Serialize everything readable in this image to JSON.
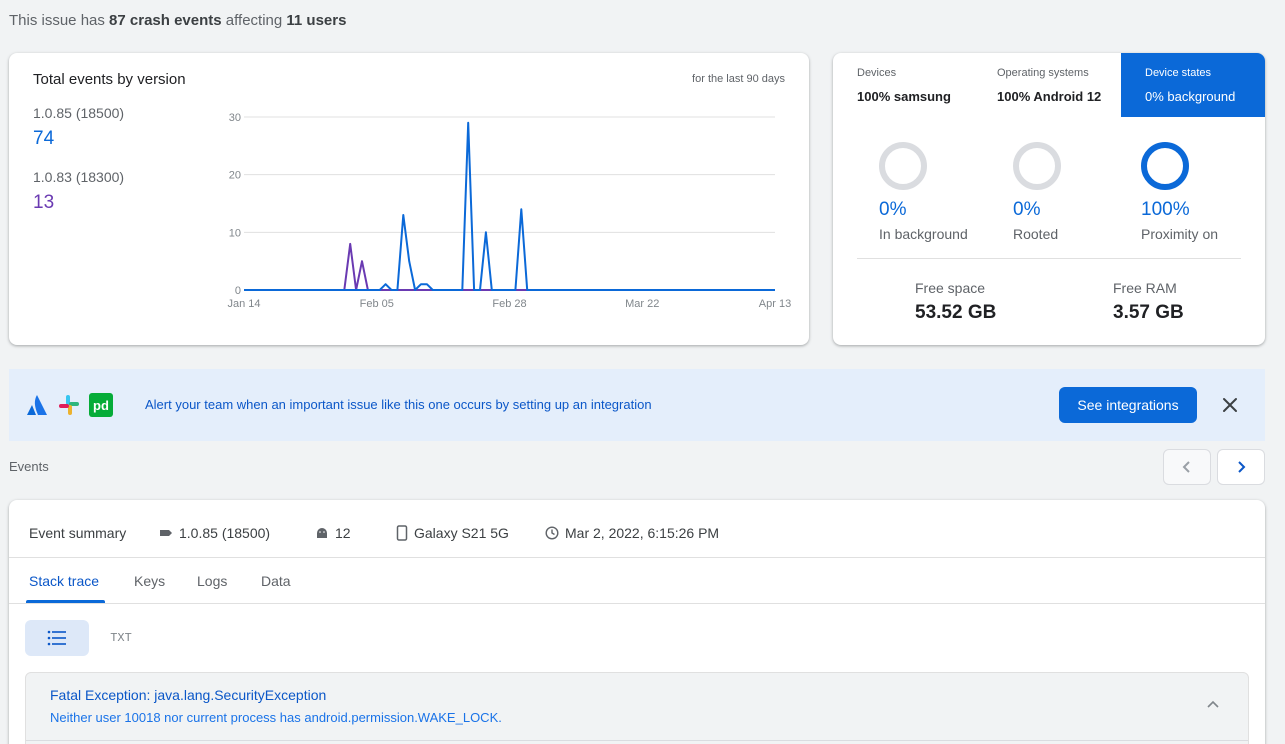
{
  "summary": {
    "prefix": "This issue has",
    "events": "87 crash events",
    "middle": "affecting",
    "users": "11 users"
  },
  "chart_card": {
    "title": "Total events by version",
    "period": "for the last 90 days",
    "versions": [
      {
        "label": "1.0.85 (18500)",
        "value": "74",
        "color": "#0b69d8"
      },
      {
        "label": "1.0.83 (18300)",
        "value": "13",
        "color": "#6a3ab2"
      }
    ]
  },
  "chart_data": {
    "type": "line",
    "title": "Total events by version",
    "x_ticks": [
      "Jan 14",
      "Feb 05",
      "Feb 28",
      "Mar 22",
      "Apr 13"
    ],
    "x_range_days": [
      0,
      90
    ],
    "y_ticks": [
      "0",
      "10",
      "20",
      "30"
    ],
    "ylim": [
      0,
      30
    ],
    "grid": true,
    "series": [
      {
        "name": "1.0.85 (18500)",
        "color": "#0b69d8",
        "points": [
          [
            0,
            0
          ],
          [
            23,
            0
          ],
          [
            24,
            1
          ],
          [
            25,
            0
          ],
          [
            26,
            0
          ],
          [
            27,
            13
          ],
          [
            28,
            5
          ],
          [
            29,
            0
          ],
          [
            30,
            1
          ],
          [
            31,
            1
          ],
          [
            32,
            0
          ],
          [
            37,
            0
          ],
          [
            38,
            29
          ],
          [
            39,
            0
          ],
          [
            40,
            0
          ],
          [
            41,
            10
          ],
          [
            42,
            0
          ],
          [
            46,
            0
          ],
          [
            47,
            14
          ],
          [
            48,
            0
          ],
          [
            90,
            0
          ]
        ]
      },
      {
        "name": "1.0.83 (18300)",
        "color": "#6a3ab2",
        "points": [
          [
            0,
            0
          ],
          [
            17,
            0
          ],
          [
            18,
            8
          ],
          [
            19,
            0
          ],
          [
            20,
            5
          ],
          [
            21,
            0
          ],
          [
            90,
            0
          ]
        ]
      }
    ]
  },
  "device_tabs": [
    {
      "label": "Devices",
      "value": "100% samsung",
      "active": false
    },
    {
      "label": "Operating systems",
      "value": "100% Android 12",
      "active": false
    },
    {
      "label": "Device states",
      "value": "0% background",
      "active": true
    }
  ],
  "device_states": [
    {
      "pct": "0%",
      "label": "In background",
      "fill": 0
    },
    {
      "pct": "0%",
      "label": "Rooted",
      "fill": 0
    },
    {
      "pct": "100%",
      "label": "Proximity on",
      "fill": 1
    }
  ],
  "memory": [
    {
      "label": "Free space",
      "value": "53.52 GB"
    },
    {
      "label": "Free RAM",
      "value": "3.57 GB"
    }
  ],
  "alert": {
    "text": "Alert your team when an important issue like this one occurs by setting up an integration",
    "button": "See integrations",
    "logos": [
      "atlassian-icon",
      "slack-icon",
      "pagerduty-icon"
    ],
    "pagerduty_text": "pd"
  },
  "events": {
    "label": "Events",
    "summary_label": "Event summary",
    "version": "1.0.85 (18500)",
    "os": "12",
    "device": "Galaxy S21 5G",
    "time": "Mar 2, 2022, 6:15:26 PM",
    "tabs": [
      "Stack trace",
      "Keys",
      "Logs",
      "Data"
    ],
    "active_tab": "Stack trace",
    "view_txt": "TXT",
    "exception_title": "Fatal Exception: java.lang.SecurityException",
    "exception_message": "Neither user 10018 nor current process has android.permission.WAKE_LOCK."
  },
  "colors": {
    "primary": "#0b69d8",
    "purple": "#6a3ab2",
    "banner_bg": "#e4eefb"
  }
}
